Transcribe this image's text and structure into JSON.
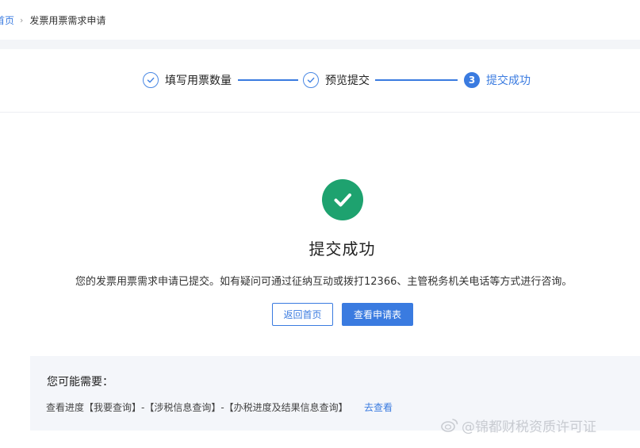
{
  "breadcrumb": {
    "home": "首页",
    "separator": "›",
    "current": "发票用票需求申请"
  },
  "steps": [
    {
      "label": "填写用票数量",
      "state": "done",
      "icon": "check-circle-icon"
    },
    {
      "label": "预览提交",
      "state": "done",
      "icon": "check-circle-icon"
    },
    {
      "label": "提交成功",
      "state": "active",
      "number": "3"
    }
  ],
  "result": {
    "icon": "success-check-icon",
    "title": "提交成功",
    "description": "您的发票用票需求申请已提交。如有疑问可通过征纳互动或拨打12366、主管税务机关电话等方式进行咨询。"
  },
  "buttons": {
    "back_home": "返回首页",
    "view_application": "查看申请表"
  },
  "suggestions": {
    "title": "您可能需要：",
    "path": "查看进度【我要查询】-【涉税信息查询】-【办税进度及结果信息查询】",
    "link": "去查看"
  },
  "watermark": {
    "text": "@锦都财税资质许可证",
    "icon": "weibo-logo-icon"
  },
  "colors": {
    "primary": "#3a7be0",
    "success": "#1ea26f",
    "background": "#f3f5f8"
  }
}
